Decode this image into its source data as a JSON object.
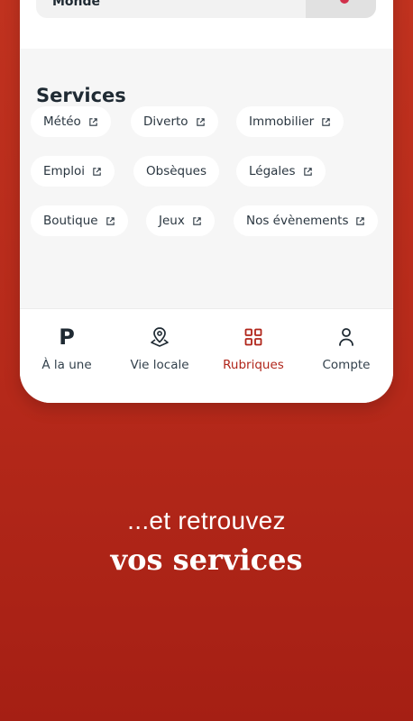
{
  "article": {
    "label": "Monde"
  },
  "services": {
    "title": "Services",
    "items": [
      {
        "label": "Météo",
        "external": true
      },
      {
        "label": "Diverto",
        "external": true
      },
      {
        "label": "Immobilier",
        "external": true
      },
      {
        "label": "Emploi",
        "external": true
      },
      {
        "label": "Obsèques",
        "external": false
      },
      {
        "label": "Légales",
        "external": true
      },
      {
        "label": "Boutique",
        "external": true
      },
      {
        "label": "Jeux",
        "external": true
      },
      {
        "label": "Nos évènements",
        "external": true
      }
    ]
  },
  "nav": {
    "items": [
      {
        "label": "À la une",
        "icon": "p-logo-icon"
      },
      {
        "label": "Vie locale",
        "icon": "map-pin-icon"
      },
      {
        "label": "Rubriques",
        "icon": "grid-icon",
        "active": true
      },
      {
        "label": "Compte",
        "icon": "user-icon"
      }
    ],
    "logo_letter": "P"
  },
  "tagline": {
    "line1": "...et retrouvez",
    "line2": "vos services"
  },
  "colors": {
    "brand_red": "#b5291a",
    "active_nav": "#b0251a",
    "text_dark": "#1f2a33"
  }
}
